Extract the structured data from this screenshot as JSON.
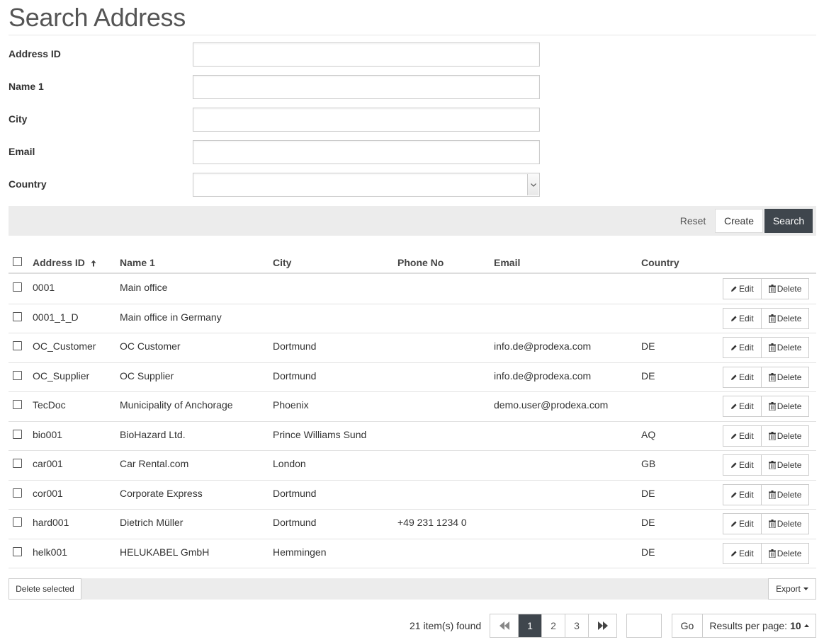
{
  "page": {
    "title": "Search Address"
  },
  "form": {
    "fields": [
      {
        "label": "Address ID",
        "value": ""
      },
      {
        "label": "Name 1",
        "value": ""
      },
      {
        "label": "City",
        "value": ""
      },
      {
        "label": "Email",
        "value": ""
      },
      {
        "label": "Country",
        "value": ""
      }
    ]
  },
  "actions": {
    "reset": "Reset",
    "create": "Create",
    "search": "Search"
  },
  "table": {
    "columns": [
      "Address ID",
      "Name 1",
      "City",
      "Phone No",
      "Email",
      "Country"
    ],
    "sort_icon": "arrow-up-icon",
    "edit_label": "Edit",
    "delete_label": "Delete",
    "rows": [
      {
        "id": "0001",
        "name": "Main office",
        "city": "",
        "phone": "",
        "email": "",
        "country": ""
      },
      {
        "id": "0001_1_D",
        "name": "Main office in Germany",
        "city": "",
        "phone": "",
        "email": "",
        "country": ""
      },
      {
        "id": "OC_Customer",
        "name": "OC Customer",
        "city": "Dortmund",
        "phone": "",
        "email": "info.de@prodexa.com",
        "country": "DE"
      },
      {
        "id": "OC_Supplier",
        "name": "OC Supplier",
        "city": "Dortmund",
        "phone": "",
        "email": "info.de@prodexa.com",
        "country": "DE"
      },
      {
        "id": "TecDoc",
        "name": "Municipality of Anchorage",
        "city": "Phoenix",
        "phone": "",
        "email": "demo.user@prodexa.com",
        "country": ""
      },
      {
        "id": "bio001",
        "name": "BioHazard Ltd.",
        "city": "Prince Williams Sund",
        "phone": "",
        "email": "",
        "country": "AQ"
      },
      {
        "id": "car001",
        "name": "Car Rental.com",
        "city": "London",
        "phone": "",
        "email": "",
        "country": "GB"
      },
      {
        "id": "cor001",
        "name": "Corporate Express",
        "city": "Dortmund",
        "phone": "",
        "email": "",
        "country": "DE"
      },
      {
        "id": "hard001",
        "name": "Dietrich Müller",
        "city": "Dortmund",
        "phone": "+49 231 1234 0",
        "email": "",
        "country": "DE"
      },
      {
        "id": "helk001",
        "name": "HELUKABEL GmbH",
        "city": "Hemmingen",
        "phone": "",
        "email": "",
        "country": "DE"
      }
    ]
  },
  "footer": {
    "delete_selected": "Delete selected",
    "export": "Export",
    "items_found": "21 item(s) found",
    "pages": [
      "1",
      "2",
      "3"
    ],
    "active_page": "1",
    "go": "Go",
    "results_per_page_label": "Results per page:",
    "results_per_page_value": "10"
  },
  "colors": {
    "dark_button": "#3f464d",
    "bar_background": "#ececec"
  }
}
